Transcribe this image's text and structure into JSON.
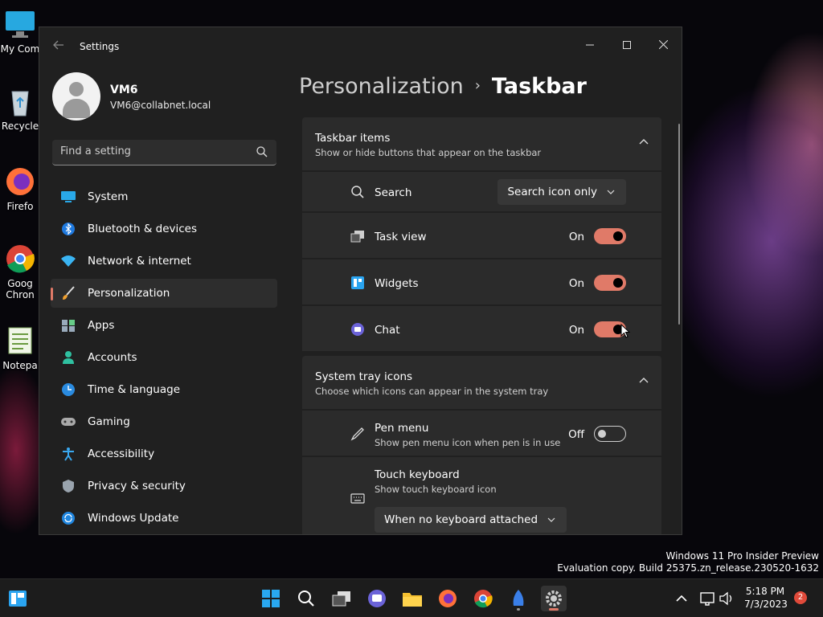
{
  "desktop": {
    "icons": [
      {
        "label": "My Com",
        "icon": "monitor-icon"
      },
      {
        "label": "Recycle",
        "icon": "recycle-bin-icon"
      },
      {
        "label": "Firefo",
        "icon": "firefox-icon"
      },
      {
        "label": "Goog",
        "label2": "Chron",
        "icon": "chrome-icon"
      },
      {
        "label": "Notepa",
        "icon": "notepad-icon"
      }
    ],
    "watermark_line1": "Windows 11 Pro Insider Preview",
    "watermark_line2": "Evaluation copy. Build 25375.zn_release.230520-1632"
  },
  "window": {
    "app_title": "Settings",
    "controls": {
      "minimize": "—",
      "maximize": "☐",
      "close": "✕"
    }
  },
  "user": {
    "name": "VM6",
    "email": "VM6@collabnet.local"
  },
  "search": {
    "placeholder": "Find a setting"
  },
  "nav": {
    "items": [
      {
        "label": "System",
        "icon": "system-icon"
      },
      {
        "label": "Bluetooth & devices",
        "icon": "bluetooth-icon"
      },
      {
        "label": "Network & internet",
        "icon": "network-icon"
      },
      {
        "label": "Personalization",
        "icon": "brush-icon",
        "active": true
      },
      {
        "label": "Apps",
        "icon": "apps-icon"
      },
      {
        "label": "Accounts",
        "icon": "accounts-icon"
      },
      {
        "label": "Time & language",
        "icon": "time-language-icon"
      },
      {
        "label": "Gaming",
        "icon": "gaming-icon"
      },
      {
        "label": "Accessibility",
        "icon": "accessibility-icon"
      },
      {
        "label": "Privacy & security",
        "icon": "shield-icon"
      },
      {
        "label": "Windows Update",
        "icon": "update-icon"
      }
    ]
  },
  "breadcrumb": {
    "parent": "Personalization",
    "separator": "›",
    "current": "Taskbar"
  },
  "taskbar_items": {
    "title": "Taskbar items",
    "subtitle": "Show or hide buttons that appear on the taskbar",
    "search": {
      "label": "Search",
      "value": "Search icon only"
    },
    "task_view": {
      "label": "Task view",
      "state": "On"
    },
    "widgets": {
      "label": "Widgets",
      "state": "On"
    },
    "chat": {
      "label": "Chat",
      "state": "On"
    }
  },
  "system_tray": {
    "title": "System tray icons",
    "subtitle": "Choose which icons can appear in the system tray",
    "pen_menu": {
      "label": "Pen menu",
      "desc": "Show pen menu icon when pen is in use",
      "state": "Off"
    },
    "touch_keyboard": {
      "label": "Touch keyboard",
      "desc": "Show touch keyboard icon",
      "value": "When no keyboard attached"
    }
  },
  "taskbar": {
    "time": "5:18 PM",
    "date": "7/3/2023",
    "notification_count": "2"
  },
  "colors": {
    "accent": "#e07a68",
    "window_bg": "#202020",
    "card_bg": "#2b2b2b"
  }
}
